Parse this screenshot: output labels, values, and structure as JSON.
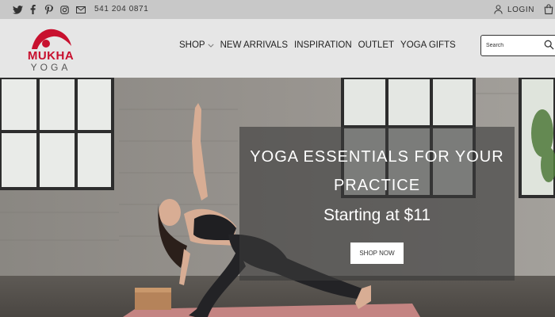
{
  "topbar": {
    "social_icons": [
      "twitter-icon",
      "facebook-icon",
      "pinterest-icon",
      "instagram-icon",
      "mail-icon"
    ],
    "phone": "541 204 0871",
    "login_label": "LOGIN",
    "cart_icon": "shopping-bag-icon"
  },
  "header": {
    "logo": {
      "name": "MUKHA",
      "subname": "YOGA"
    },
    "nav": [
      {
        "label": "SHOP",
        "has_dropdown": true
      },
      {
        "label": "NEW ARRIVALS"
      },
      {
        "label": "INSPIRATION"
      },
      {
        "label": "OUTLET"
      },
      {
        "label": "YOGA GIFTS"
      }
    ],
    "search": {
      "placeholder": "Search",
      "value": ""
    }
  },
  "hero": {
    "headline": "YOGA ESSENTIALS FOR YOUR PRACTICE",
    "subheadline": "Starting at $11",
    "cta_label": "SHOP NOW"
  },
  "colors": {
    "brand_red": "#c8102e",
    "topbar_bg": "#c8c8c8",
    "header_bg": "#e6e6e6",
    "overlay": "#3a3a3a"
  }
}
